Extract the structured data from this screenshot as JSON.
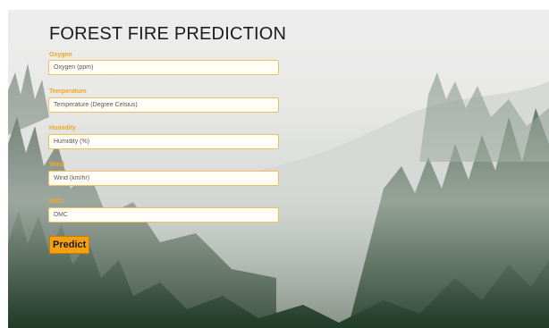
{
  "page": {
    "title": "FOREST FIRE PREDICTION"
  },
  "fields": [
    {
      "label": "Oxygen",
      "placeholder": "Oxygen (ppm)"
    },
    {
      "label": "Temperature",
      "placeholder": "Temperature (Degree Celsius)"
    },
    {
      "label": "Humidity",
      "placeholder": "Humidity (%)"
    },
    {
      "label": "Wind",
      "placeholder": "Wind (km/hr)"
    },
    {
      "label": "DMC",
      "placeholder": "DMC"
    }
  ],
  "actions": {
    "predict_label": "Predict"
  },
  "colors": {
    "label": "#f2a81d",
    "input_border": "#f0c05a",
    "button_bg": "#f5a00f",
    "title": "#1b1b1b"
  }
}
